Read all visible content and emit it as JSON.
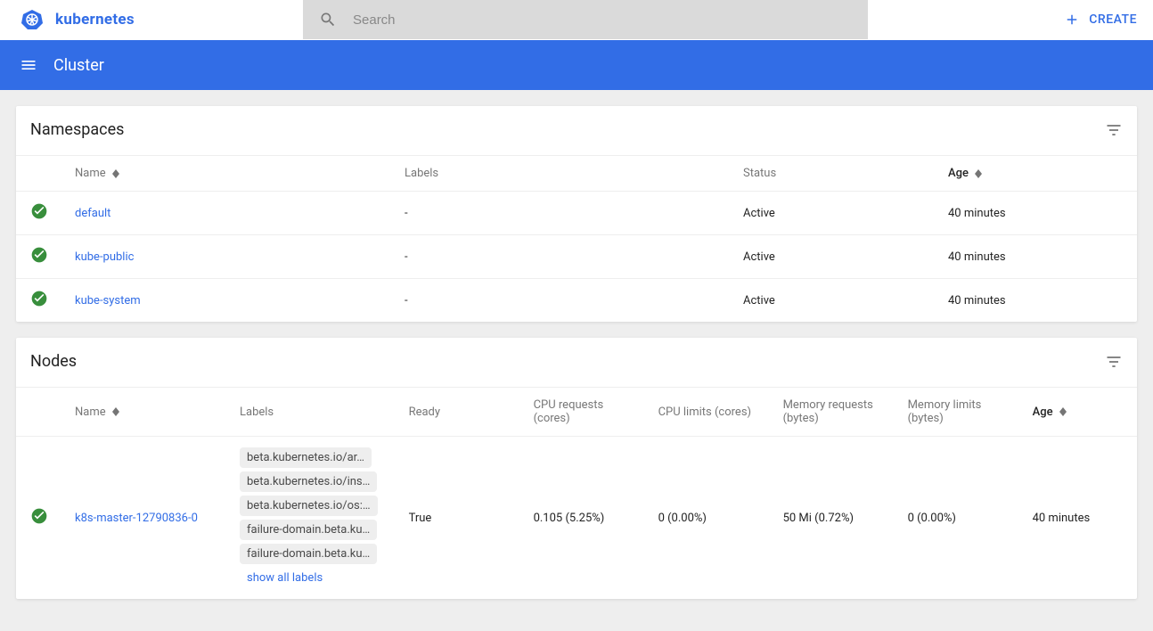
{
  "header": {
    "logo_text": "kubernetes",
    "search_placeholder": "Search",
    "create_label": "CREATE"
  },
  "subheader": {
    "title": "Cluster"
  },
  "namespaces": {
    "title": "Namespaces",
    "columns": {
      "name": "Name",
      "labels": "Labels",
      "status": "Status",
      "age": "Age"
    },
    "rows": [
      {
        "name": "default",
        "labels": "-",
        "status": "Active",
        "age": "40 minutes"
      },
      {
        "name": "kube-public",
        "labels": "-",
        "status": "Active",
        "age": "40 minutes"
      },
      {
        "name": "kube-system",
        "labels": "-",
        "status": "Active",
        "age": "40 minutes"
      }
    ]
  },
  "nodes": {
    "title": "Nodes",
    "columns": {
      "name": "Name",
      "labels": "Labels",
      "ready": "Ready",
      "cpu_req": "CPU requests (cores)",
      "cpu_lim": "CPU limits (cores)",
      "mem_req": "Memory requests (bytes)",
      "mem_lim": "Memory limits (bytes)",
      "age": "Age"
    },
    "rows": [
      {
        "name": "k8s-master-12790836-0",
        "labels": [
          "beta.kubernetes.io/ar…",
          "beta.kubernetes.io/ins…",
          "beta.kubernetes.io/os:…",
          "failure-domain.beta.ku…",
          "failure-domain.beta.ku…"
        ],
        "show_all": "show all labels",
        "ready": "True",
        "cpu_req": "0.105 (5.25%)",
        "cpu_lim": "0 (0.00%)",
        "mem_req": "50 Mi (0.72%)",
        "mem_lim": "0 (0.00%)",
        "age": "40 minutes"
      }
    ]
  }
}
